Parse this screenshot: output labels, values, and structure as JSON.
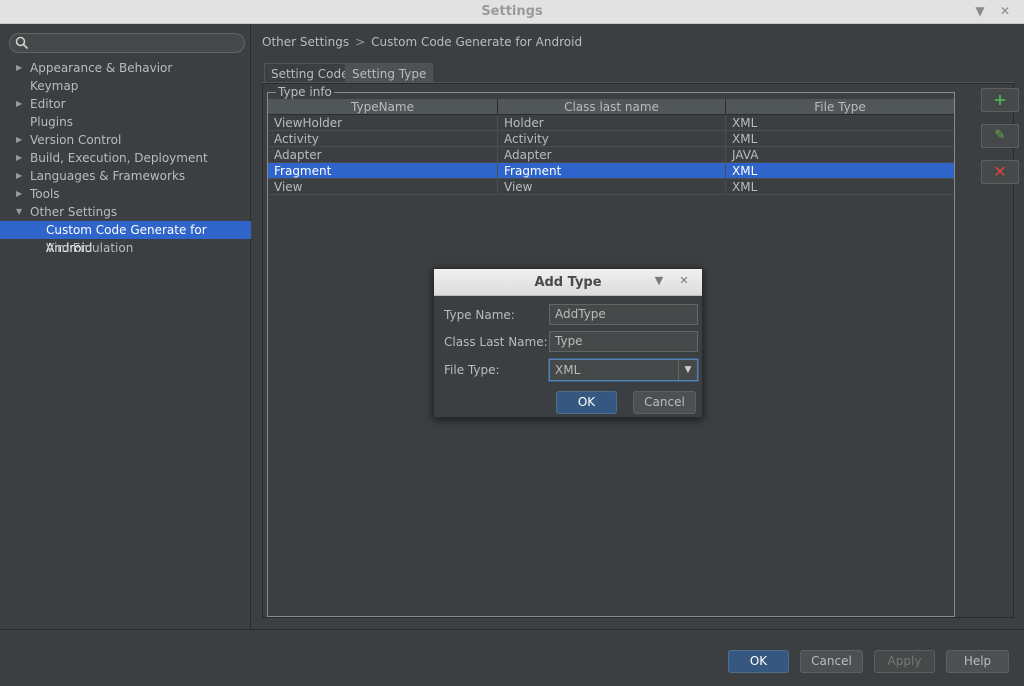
{
  "window": {
    "title": "Settings"
  },
  "sidebar": {
    "search": {
      "value": ""
    },
    "items": [
      {
        "label": "Appearance & Behavior",
        "arrow": "▶"
      },
      {
        "label": "Keymap",
        "arrow": ""
      },
      {
        "label": "Editor",
        "arrow": "▶"
      },
      {
        "label": "Plugins",
        "arrow": ""
      },
      {
        "label": "Version Control",
        "arrow": "▶"
      },
      {
        "label": "Build, Execution, Deployment",
        "arrow": "▶"
      },
      {
        "label": "Languages & Frameworks",
        "arrow": "▶"
      },
      {
        "label": "Tools",
        "arrow": "▶"
      },
      {
        "label": "Other Settings",
        "arrow": "▼"
      },
      {
        "label": "Custom Code Generate for Android",
        "arrow": ""
      },
      {
        "label": "Vim Emulation",
        "arrow": ""
      }
    ]
  },
  "main": {
    "breadcrumb": {
      "parent": "Other Settings",
      "separator": ">",
      "current": "Custom Code Generate for Android"
    },
    "tabs": [
      {
        "label": "Setting Code"
      },
      {
        "label": "Setting Type"
      }
    ],
    "fieldset_title": "Type info",
    "table": {
      "headers": [
        "TypeName",
        "Class last name",
        "File Type"
      ],
      "rows": [
        [
          "ViewHolder",
          "Holder",
          "XML"
        ],
        [
          "Activity",
          "Activity",
          "XML"
        ],
        [
          "Adapter",
          "Adapter",
          "JAVA"
        ],
        [
          "Fragment",
          "Fragment",
          "XML"
        ],
        [
          "View",
          "View",
          "XML"
        ]
      ],
      "selected_row": 3
    },
    "side_buttons": [
      {
        "icon": "add-icon",
        "glyph": "+",
        "color": "#4caf50"
      },
      {
        "icon": "edit-icon",
        "glyph": "✎",
        "color": "#62b543"
      },
      {
        "icon": "remove-icon",
        "glyph": "✕",
        "color": "#e0443e"
      }
    ]
  },
  "dialog": {
    "title": "Add Type",
    "type_name_label": "Type Name:",
    "type_name_value": "AddType",
    "class_last_name_label": "Class Last Name:",
    "class_last_name_value": "Type",
    "file_type_label": "File Type:",
    "file_type_value": "XML",
    "ok_label": "OK",
    "cancel_label": "Cancel"
  },
  "footer": {
    "ok": "OK",
    "cancel": "Cancel",
    "apply": "Apply",
    "help": "Help"
  },
  "colors": {
    "selection": "#2f65ca",
    "background": "#3c3f41",
    "default_button": "#365880"
  }
}
